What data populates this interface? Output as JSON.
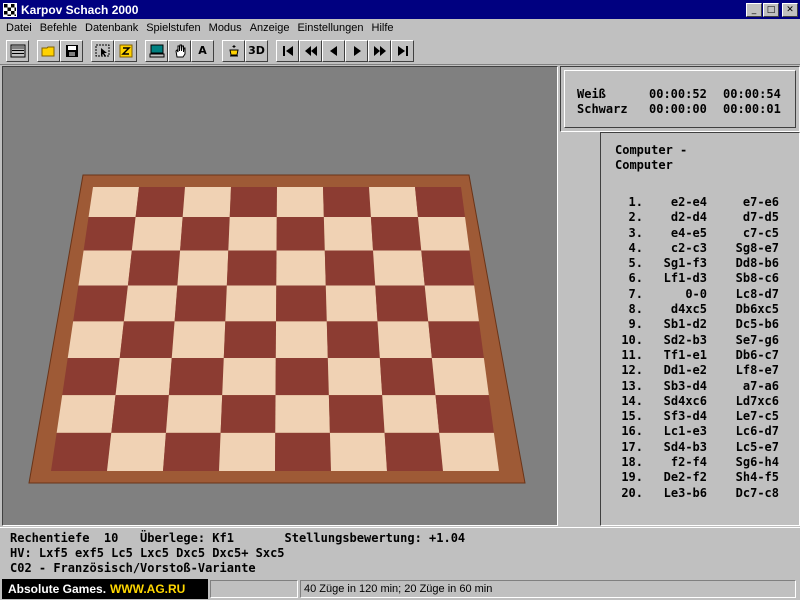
{
  "window": {
    "title": "Karpov Schach 2000",
    "min": "_",
    "max": "□",
    "close": "✕"
  },
  "menu": [
    "Datei",
    "Befehle",
    "Datenbank",
    "Spielstufen",
    "Modus",
    "Anzeige",
    "Einstellungen",
    "Hilfe"
  ],
  "toolbar": {
    "a_label": "A",
    "three_d_label": "3D"
  },
  "clocks": {
    "white": {
      "label": "Weiß",
      "time1": "00:00:52",
      "time2": "00:00:54"
    },
    "black": {
      "label": "Schwarz",
      "time1": "00:00:00",
      "time2": "00:00:01"
    }
  },
  "moves": {
    "header_line1": "Computer -",
    "header_line2": "Computer",
    "rows": [
      {
        "n": "1.",
        "w": "e2-e4",
        "b": "e7-e6"
      },
      {
        "n": "2.",
        "w": "d2-d4",
        "b": "d7-d5"
      },
      {
        "n": "3.",
        "w": "e4-e5",
        "b": "c7-c5"
      },
      {
        "n": "4.",
        "w": "c2-c3",
        "b": "Sg8-e7"
      },
      {
        "n": "5.",
        "w": "Sg1-f3",
        "b": "Dd8-b6"
      },
      {
        "n": "6.",
        "w": "Lf1-d3",
        "b": "Sb8-c6"
      },
      {
        "n": "7.",
        "w": "0-0",
        "b": "Lc8-d7"
      },
      {
        "n": "8.",
        "w": "d4xc5",
        "b": "Db6xc5"
      },
      {
        "n": "9.",
        "w": "Sb1-d2",
        "b": "Dc5-b6"
      },
      {
        "n": "10.",
        "w": "Sd2-b3",
        "b": "Se7-g6"
      },
      {
        "n": "11.",
        "w": "Tf1-e1",
        "b": "Db6-c7"
      },
      {
        "n": "12.",
        "w": "Dd1-e2",
        "b": "Lf8-e7"
      },
      {
        "n": "13.",
        "w": "Sb3-d4",
        "b": "a7-a6"
      },
      {
        "n": "14.",
        "w": "Sd4xc6",
        "b": "Ld7xc6"
      },
      {
        "n": "15.",
        "w": "Sf3-d4",
        "b": "Le7-c5"
      },
      {
        "n": "16.",
        "w": "Lc1-e3",
        "b": "Lc6-d7"
      },
      {
        "n": "17.",
        "w": "Sd4-b3",
        "b": "Lc5-e7"
      },
      {
        "n": "18.",
        "w": "f2-f4",
        "b": "Sg6-h4"
      },
      {
        "n": "19.",
        "w": "De2-f2",
        "b": "Sh4-f5"
      },
      {
        "n": "20.",
        "w": "Le3-b6",
        "b": "Dc7-c8"
      }
    ]
  },
  "info": {
    "line1": "Rechentiefe  10   Überlege: Kf1       Stellungsbewertung: +1.04",
    "line2": "HV: Lxf5 exf5 Lc5 Lxc5 Dxc5 Dxc5+ Sxc5",
    "line3": "C02 - Französisch/Vorstoß-Variante"
  },
  "status": {
    "brand": "Absolute Games.",
    "brand_url": "WWW.AG.RU",
    "time_control": "40 Züge in 120 min; 20 Züge in 60 min"
  },
  "colors": {
    "title_bg": "#000080",
    "board_light": "#f0d2b4",
    "board_dark": "#8c3c32",
    "board_frame": "#9e5a36",
    "viewport_bg": "#808080",
    "white_piece": "#d08a4e",
    "black_piece": "#3f5a40"
  },
  "icons": {
    "toolbar": [
      "board-icon",
      "open-folder-icon",
      "save-disk-icon",
      "cursor-select-icon",
      "book-icon",
      "computer-icon",
      "hand-icon",
      "a-letter-icon",
      "king-icon",
      "3d-icon",
      "first-move-icon",
      "rewind-icon",
      "back-icon",
      "forward-icon",
      "fast-forward-icon",
      "last-move-icon"
    ]
  }
}
